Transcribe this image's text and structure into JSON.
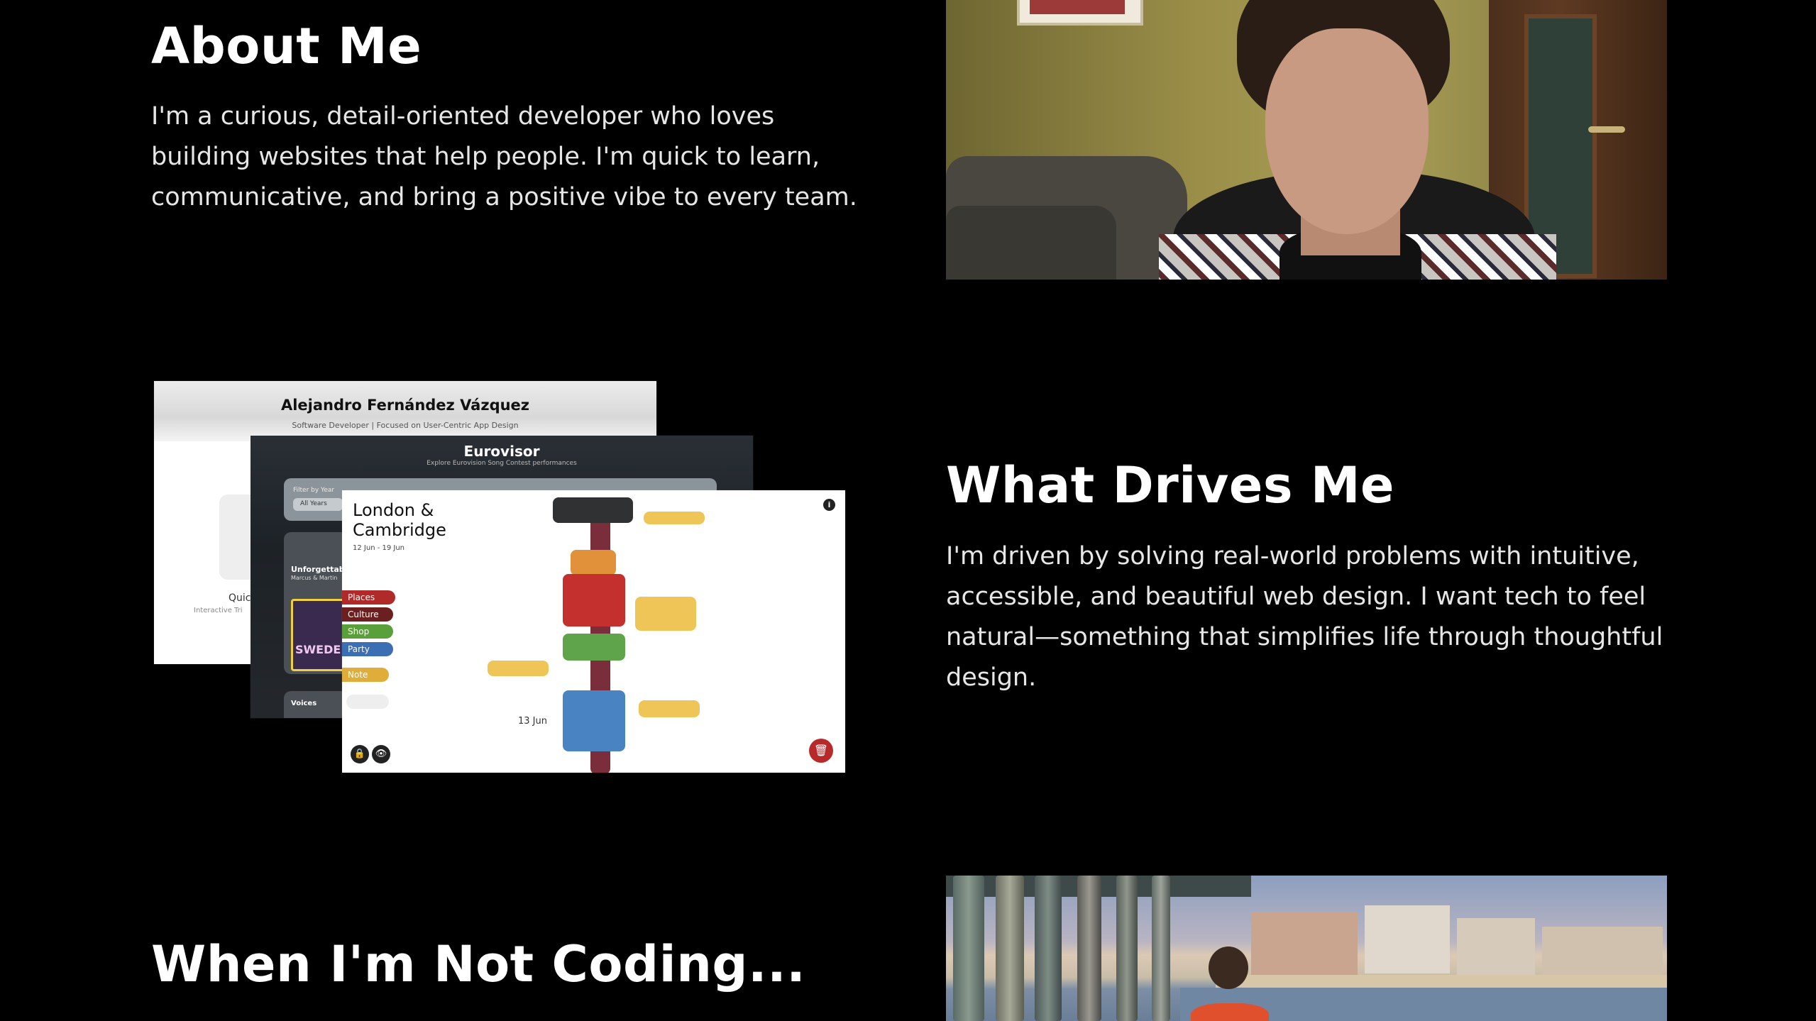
{
  "about": {
    "title": "About Me",
    "text": "I'm a curious, detail-oriented developer who loves building websites that help people. I'm quick to learn, communicative, and bring a positive vibe to every team."
  },
  "drives": {
    "title": "What Drives Me",
    "text": "I'm driven by solving real-world problems with intuitive, accessible, and beautiful web design. I want tech to feel natural—something that simplifies life through thoughtful design."
  },
  "not_coding": {
    "title": "When I'm Not Coding..."
  },
  "projects": {
    "portfolio": {
      "name": "Alejandro Fernández Vázquez",
      "subtitle": "Software Developer | Focused on User-Centric App Design",
      "card_label": "Quic",
      "card_sub": "Interactive Tri"
    },
    "eurovisor": {
      "title": "Eurovisor",
      "subtitle": "Explore Eurovision Song Contest performances",
      "filter_label": "Filter by Year",
      "filter_value": "All Years",
      "card_title": "Unforgettable",
      "card_sub": "Marcus & Martin",
      "thumb_text": "SWEDE",
      "voices": "Voices"
    },
    "trip": {
      "title": "London & Cambridge",
      "dates": "12 Jun - 19 Jun",
      "day_label": "13 Jun",
      "tags": [
        "Places",
        "Culture",
        "Shop",
        "Party",
        "Note"
      ]
    }
  },
  "icons": {
    "info": "i",
    "lock": "🔒",
    "eye": "👁",
    "trash": "🗑"
  }
}
